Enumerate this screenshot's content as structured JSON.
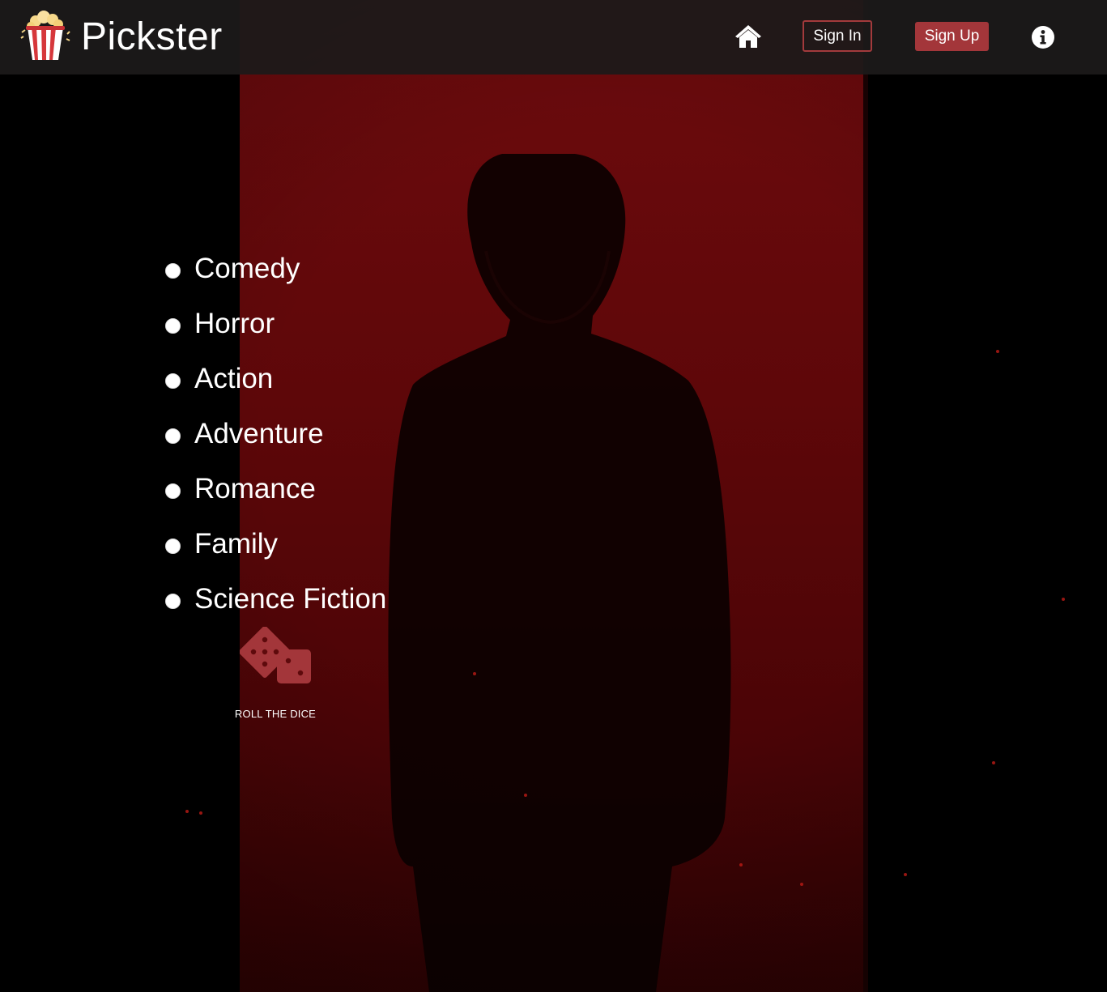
{
  "header": {
    "brand_name": "Pickster",
    "logo_icon": "popcorn-icon",
    "home_icon": "home-icon",
    "sign_in_label": "Sign In",
    "sign_up_label": "Sign Up",
    "info_icon": "info-icon"
  },
  "genres": {
    "items": [
      {
        "label": "Comedy"
      },
      {
        "label": "Horror"
      },
      {
        "label": "Action"
      },
      {
        "label": "Adventure"
      },
      {
        "label": "Romance"
      },
      {
        "label": "Family"
      },
      {
        "label": "Science Fiction"
      }
    ]
  },
  "dice": {
    "icon": "dice-icon",
    "label": "ROLL THE DICE"
  },
  "colors": {
    "accent": "#a3363a",
    "header_bg": "#1c1a1a",
    "background_red": "#6e0b0e"
  }
}
